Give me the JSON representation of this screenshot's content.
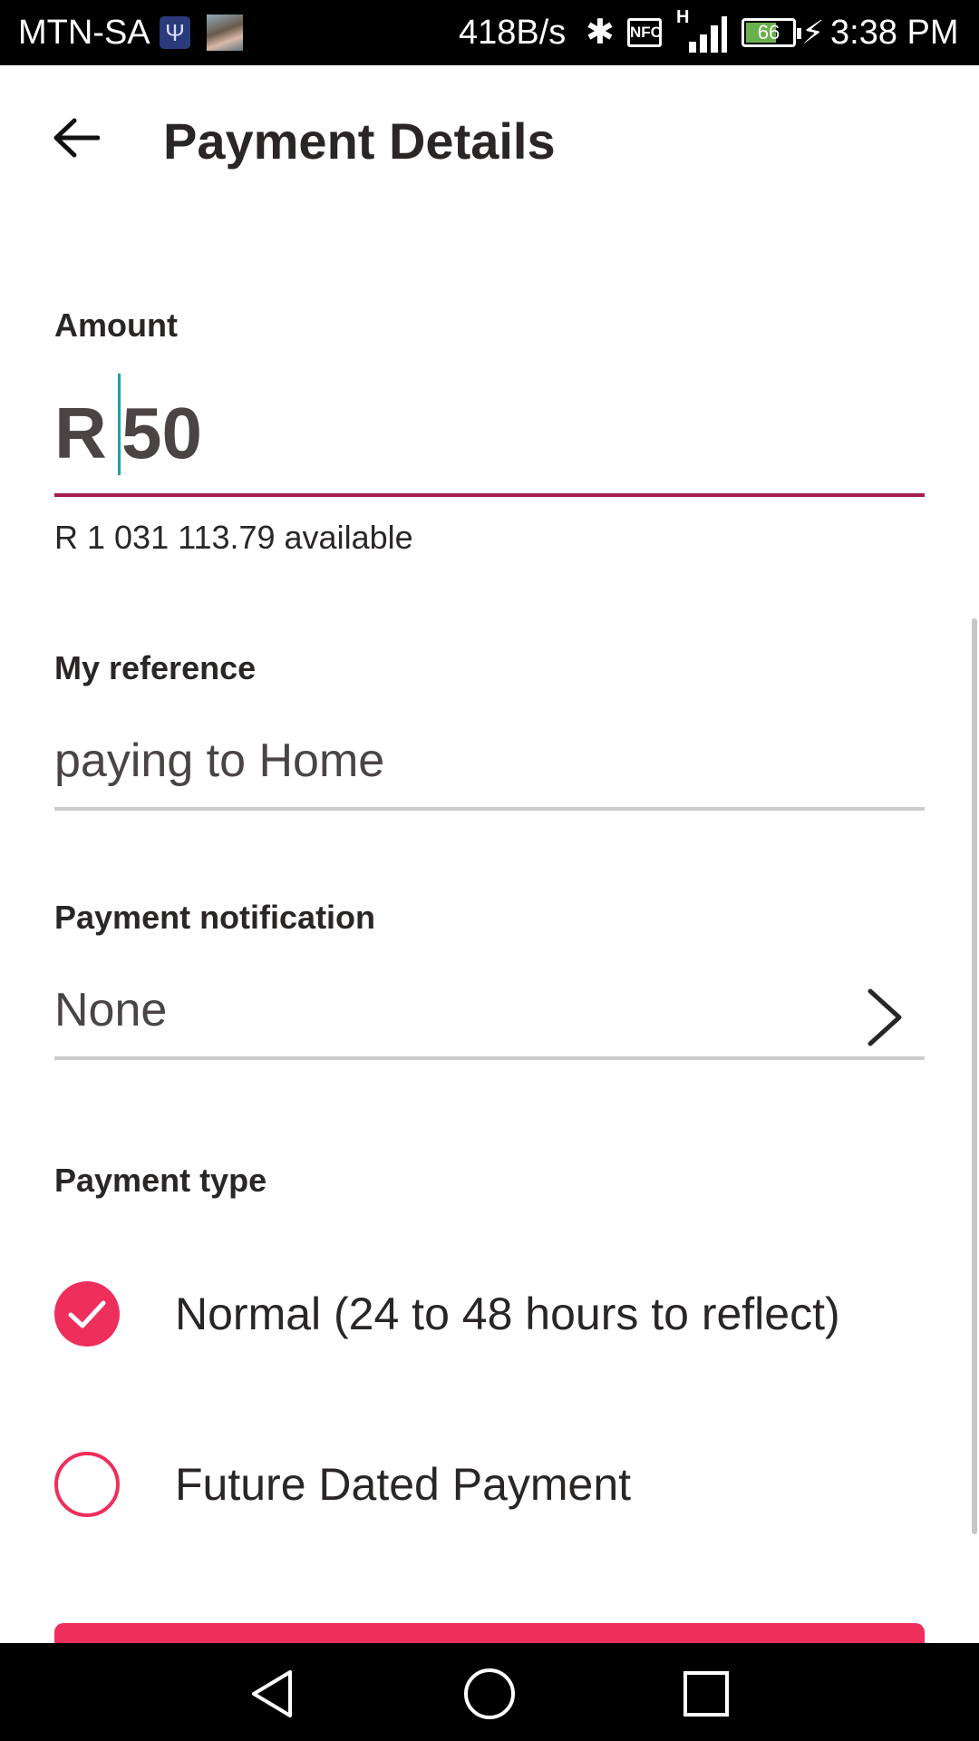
{
  "status_bar": {
    "carrier": "MTN-SA",
    "network_speed": "418B/s",
    "nfc_label": "NFC",
    "network_type": "H",
    "battery_percent": "66",
    "battery_level": 0.66,
    "time": "3:38 PM"
  },
  "header": {
    "title": "Payment Details"
  },
  "amount": {
    "label": "Amount",
    "currency": "R",
    "value": "50",
    "available": "R 1 031 113.79 available"
  },
  "reference": {
    "label": "My reference",
    "value": "paying to Home"
  },
  "notification": {
    "label": "Payment notification",
    "value": "None"
  },
  "payment_type": {
    "label": "Payment type",
    "options": [
      {
        "label": "Normal (24 to 48 hours to reflect)",
        "selected": true
      },
      {
        "label": "Future Dated Payment",
        "selected": false
      }
    ]
  },
  "colors": {
    "accent": "#ee2e5b",
    "amount_underline": "#a21c52",
    "cursor": "#1aa3a8",
    "text": "#2b2626"
  }
}
